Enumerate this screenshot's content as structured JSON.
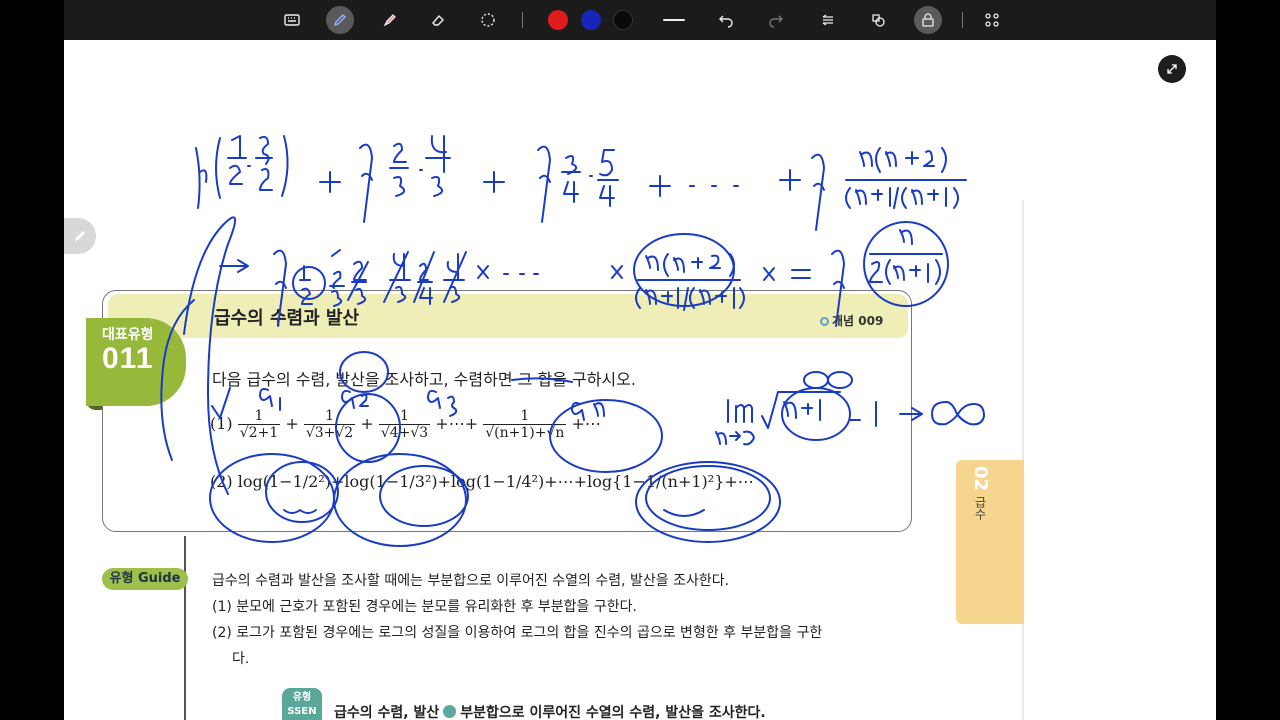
{
  "toolbar": {
    "tools": [
      "keyboard-icon",
      "pen-icon",
      "highlighter-icon",
      "eraser-icon",
      "lasso-icon"
    ],
    "colors": [
      "#e01b1b",
      "#1626b8",
      "#0a0a0a"
    ],
    "actions": [
      "line-width-icon",
      "undo-icon",
      "redo-icon",
      "layers-icon",
      "shapes-icon",
      "lock-icon",
      "grid-icon"
    ]
  },
  "header": {
    "title": "급수의 수렴과 발산",
    "concept_ref": "개념 009",
    "badge_label": "대표유형",
    "badge_number": "011"
  },
  "problem": {
    "question": "다음 급수의 수렴, 발산을 조사하고, 수렴하면 그 합을 구하시오.",
    "item1_label": "(1)",
    "item1_terms": [
      "1",
      "√2+1",
      "1",
      "√3+√2",
      "1",
      "√4+√3",
      "1",
      "√(n+1)+√n"
    ],
    "item1_ops": [
      "+",
      "+",
      "+⋯+",
      "+⋯"
    ],
    "item2_label": "(2)",
    "item2_text": "log(1−1/2²)+log(1−1/3²)+log(1−1/4²)+⋯+log{1−1/(n+1)²}+⋯"
  },
  "guide": {
    "label": "유형 Guide",
    "lines": [
      "급수의 수렴과 발산을 조사할 때에는 부분합으로 이루어진 수열의 수렴, 발산을 조사한다.",
      "(1) 분모에 근호가 포함된 경우에는 분모를 유리화한 후 부분합을 구한다.",
      "(2) 로그가 포함된 경우에는 로그의 성질을 이용하여 로그의 합을 진수의 곱으로 변형한 후 부분합을 구한",
      "다."
    ]
  },
  "ssen": {
    "logo_top": "유형",
    "logo_bottom": "SSEN",
    "text_left": "급수의 수렴, 발산",
    "text_right": "부분합으로 이루어진 수열의 수렴, 발산을 조사한다."
  },
  "chapter_tab": {
    "number": "02",
    "name": "급수"
  }
}
